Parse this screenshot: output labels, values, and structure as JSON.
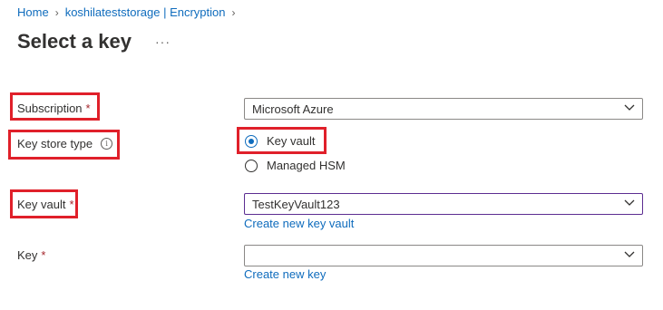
{
  "breadcrumb": {
    "items": [
      "Home",
      "koshilateststorage | Encryption"
    ],
    "separator": "›"
  },
  "header": {
    "title": "Select a key",
    "more_label": "···"
  },
  "form": {
    "subscription": {
      "label": "Subscription",
      "required_mark": "*",
      "value": "Microsoft Azure"
    },
    "key_store_type": {
      "label": "Key store type",
      "info_icon": "i",
      "options": [
        "Key vault",
        "Managed HSM"
      ],
      "selected": "Key vault"
    },
    "key_vault": {
      "label": "Key vault",
      "required_mark": "*",
      "value": "TestKeyVault123",
      "create_link": "Create new key vault"
    },
    "key": {
      "label": "Key",
      "required_mark": "*",
      "value": "",
      "create_link": "Create new key"
    }
  },
  "colors": {
    "link": "#0f6cbd",
    "required": "#a4262c",
    "highlight": "#e0202a",
    "focus_border": "#5c2d91"
  },
  "icons": [
    "chevron-right-icon",
    "more-icon",
    "info-icon",
    "chevron-down-icon"
  ]
}
